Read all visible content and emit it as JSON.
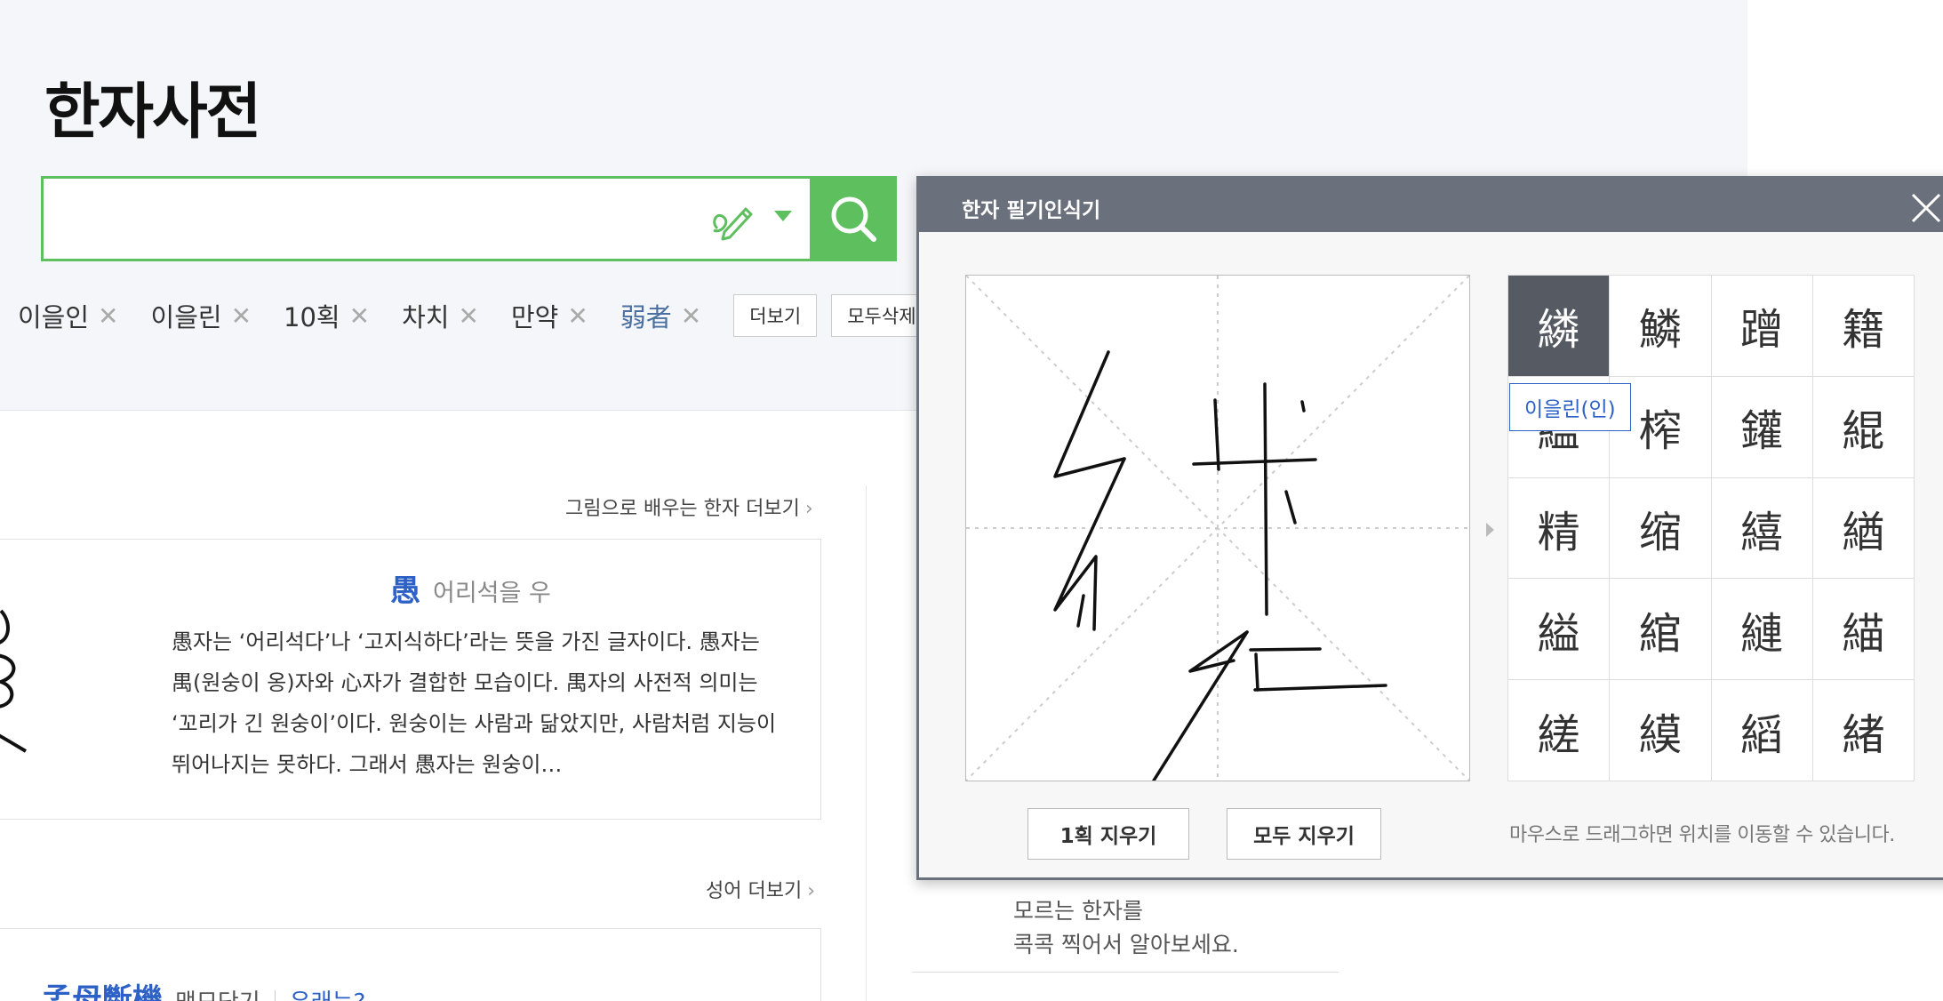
{
  "page": {
    "title": "한자사전"
  },
  "search": {
    "value": "",
    "placeholder": ""
  },
  "recent": {
    "items": [
      {
        "label": "이을인",
        "hanja": false
      },
      {
        "label": "이을린",
        "hanja": false
      },
      {
        "label": "10획",
        "hanja": false
      },
      {
        "label": "차치",
        "hanja": false
      },
      {
        "label": "만약",
        "hanja": false
      },
      {
        "label": "弱者",
        "hanja": true
      }
    ],
    "remove_glyph": "✕",
    "more_label": "더보기",
    "delete_all_label": "모두삭제"
  },
  "picture_learn": {
    "more_label": "그림으로 배우는 한자 더보기",
    "chevron": "›",
    "char": "愚",
    "reading": "어리석을 우",
    "description": "愚자는 ‘어리석다’나 ‘고지식하다’라는 뜻을 가진 글자이다. 愚자는 禺(원숭이 옹)자와 心자가 결합한 모습이다. 禺자의 사전적 의미는 ‘꼬리가 긴 원숭이’이다. 원숭이는 사람과 닮았지만, 사람처럼 지능이 뛰어나지는 못하다. 그래서 愚자는 원숭이…"
  },
  "idiom_section": {
    "more_label": "성어 더보기",
    "chevron": "›",
    "hanja": "孟母斷機",
    "reading": "맹모단기",
    "origin_link": "유래는?"
  },
  "right_panel": {
    "line1": "모르는 한자를",
    "line2": "콕콕 찍어서 알아보세요."
  },
  "handwriting": {
    "title": "한자 필기인식기",
    "candidates": [
      "繗",
      "鱗",
      "蹭",
      "籍",
      "繿",
      "榨",
      "鑵",
      "緄",
      "精",
      "缩",
      "繥",
      "緧",
      "縊",
      "綰",
      "縺",
      "緢",
      "縒",
      "縸",
      "縚",
      "緒"
    ],
    "selected_index": 0,
    "tooltip": "이을린(인)",
    "undo_label": "1획 지우기",
    "clear_label": "모두 지우기",
    "hint": "마우스로 드래그하면 위치를 이동할 수 있습니다."
  },
  "colors": {
    "accent_green": "#5ebf5e",
    "link_blue": "#2d61c5",
    "dialog_header": "#6a707c"
  }
}
